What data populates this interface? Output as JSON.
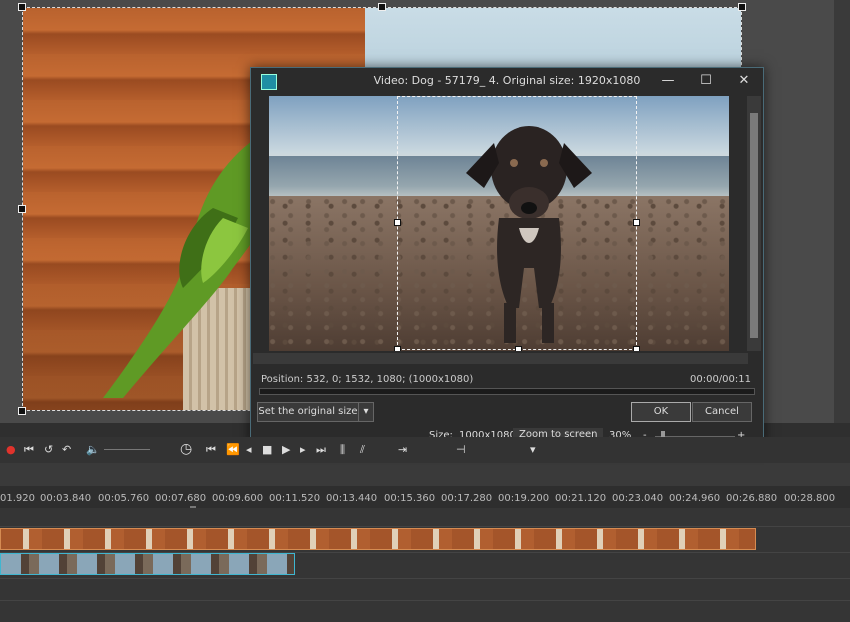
{
  "dialog": {
    "title": "Video: Dog - 57179_ 4. Original size: 1920x1080",
    "position_label": "Position:",
    "position_value": "532, 0; 1532, 1080; (1000x1080)",
    "timecode": "00:00/00:11",
    "set_original_size_label": "Set the original size",
    "ok_label": "OK",
    "cancel_label": "Cancel",
    "size_label": "Size:",
    "size_value": "1000x1080",
    "zoom_to_screen_label": "Zoom to screen",
    "zoom_value": "30%",
    "zoom_minus": "-",
    "zoom_plus": "+",
    "minimize_glyph": "—",
    "maximize_glyph": "☐",
    "close_glyph": "✕"
  },
  "timeline": {
    "ticks": [
      "01.920",
      "00:03.840",
      "00:05.760",
      "00:07.680",
      "00:09.600",
      "00:11.520",
      "00:13.440",
      "00:15.360",
      "00:17.280",
      "00:19.200",
      "00:21.120",
      "00:23.040",
      "00:24.960",
      "00:26.880",
      "00:28.800"
    ]
  },
  "colors": {
    "accent": "#1f8ea3",
    "track_selected": "#3fb6d0",
    "track_orange": "#d58b52"
  },
  "icons": [
    "app-icon",
    "record-icon",
    "play-icon",
    "stop-icon",
    "volume-icon",
    "clock-icon",
    "skip-back-icon",
    "skip-forward-icon",
    "dropdown-arrow-icon",
    "mouse-cursor-icon"
  ]
}
